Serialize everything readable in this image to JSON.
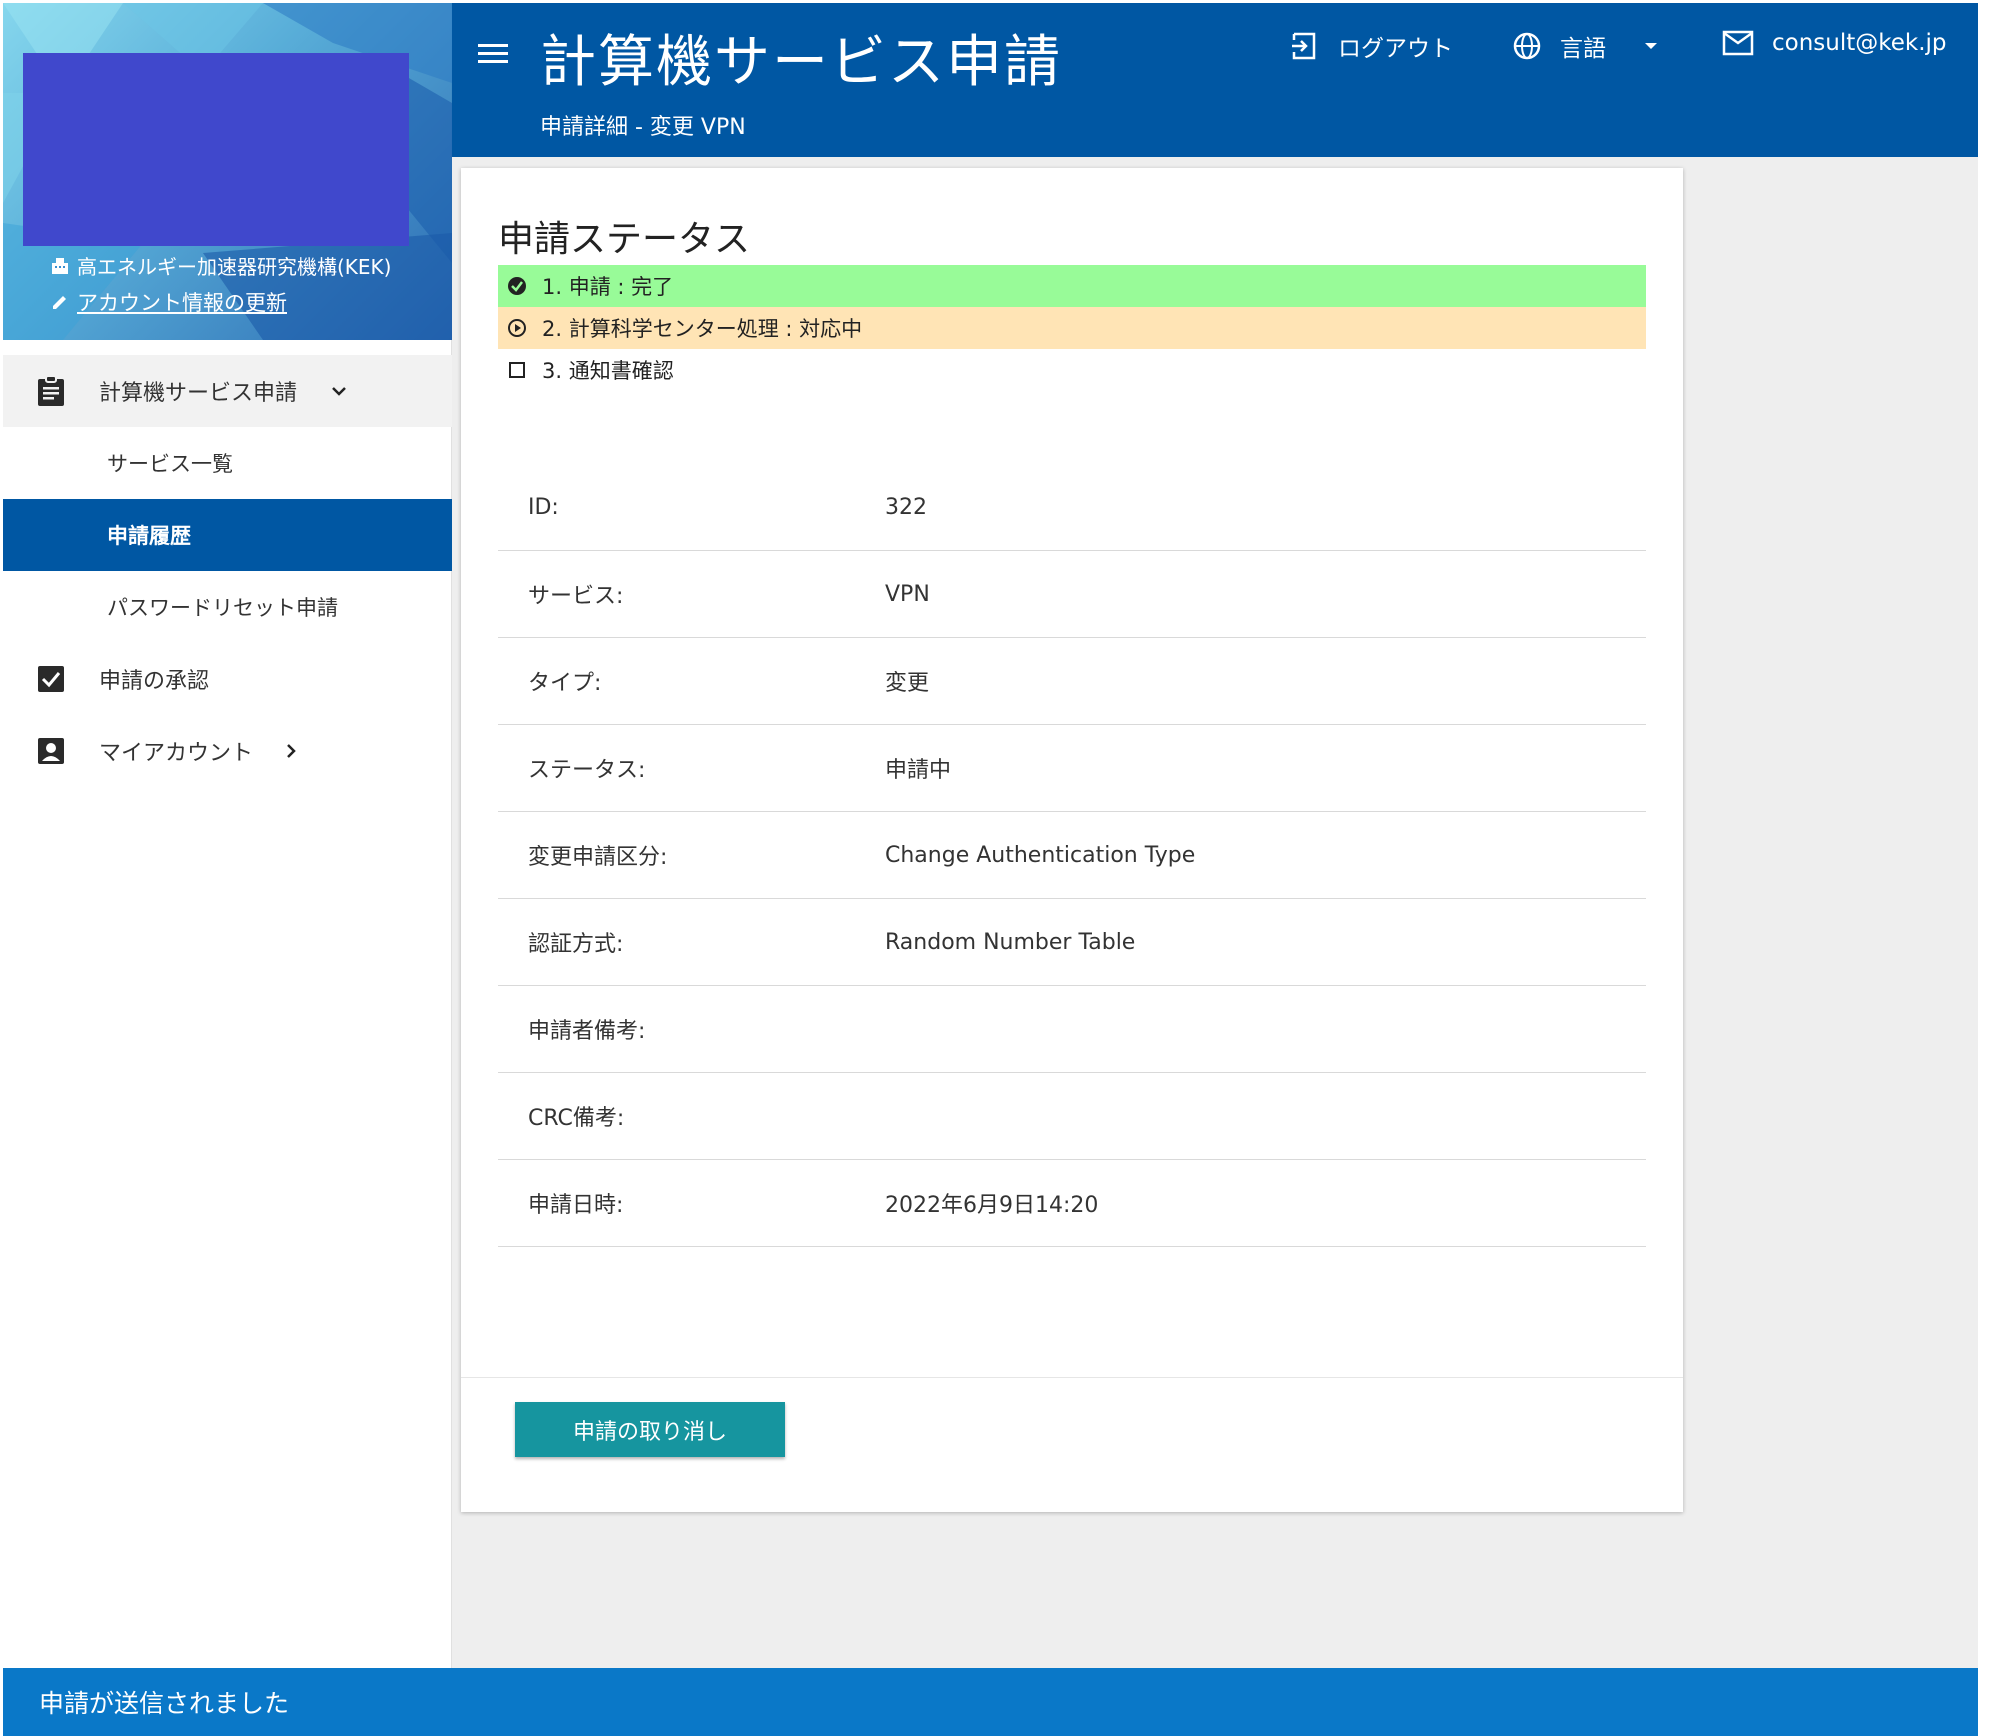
{
  "sidebar": {
    "organization": "高エネルギー加速器研究機構(KEK)",
    "account_update": "アカウント情報の更新",
    "nav": {
      "service_request": "計算機サービス申請",
      "service_list": "サービス一覧",
      "request_history": "申請履歴",
      "password_reset": "パスワードリセット申請",
      "approval": "申請の承認",
      "my_account": "マイアカウント"
    }
  },
  "header": {
    "title": "計算機サービス申請",
    "subtitle": "申請詳細 - 変更 VPN",
    "logout": "ログアウト",
    "language": "言語",
    "email": "consult@kek.jp"
  },
  "card": {
    "title": "申請ステータス",
    "steps": [
      {
        "label": "1. 申請 : 完了",
        "state": "done"
      },
      {
        "label": "2. 計算科学センター処理 : 対応中",
        "state": "in-progress"
      },
      {
        "label": "3. 通知書確認",
        "state": "pending"
      }
    ],
    "details": [
      {
        "key": "ID:",
        "value": "322"
      },
      {
        "key": "サービス:",
        "value": "VPN"
      },
      {
        "key": "タイプ:",
        "value": "変更"
      },
      {
        "key": "ステータス:",
        "value": "申請中"
      },
      {
        "key": "変更申請区分:",
        "value": "Change Authentication Type"
      },
      {
        "key": "認証方式:",
        "value": "Random Number Table"
      },
      {
        "key": "申請者備考:",
        "value": ""
      },
      {
        "key": "CRC備考:",
        "value": ""
      },
      {
        "key": "申請日時:",
        "value": "2022年6月9日14:20"
      }
    ],
    "cancel_button": "申請の取り消し"
  },
  "snackbar": {
    "message": "申請が送信されました"
  },
  "colors": {
    "primary": "#0057a3",
    "step_done": "#98fb98",
    "step_in_progress": "#ffe4b5",
    "button": "#16959f",
    "snackbar": "#0a78c8"
  }
}
